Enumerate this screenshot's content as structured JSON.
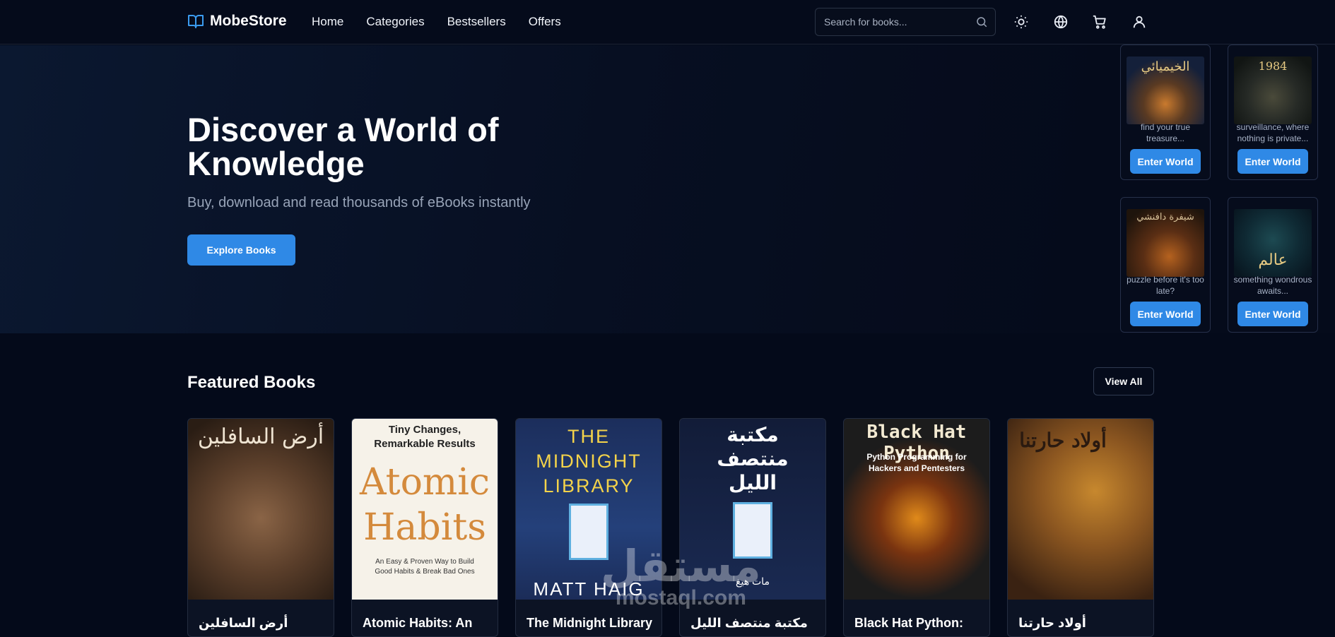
{
  "header": {
    "logo_text": "MobeStore",
    "nav": [
      "Home",
      "Categories",
      "Bestsellers",
      "Offers"
    ],
    "search_placeholder": "Search for books...",
    "icons": [
      "sun-icon",
      "globe-icon",
      "cart-icon",
      "user-icon"
    ]
  },
  "hero": {
    "title": "Discover a World of Knowledge",
    "subtitle": "Buy, download and read thousands of eBooks instantly",
    "cta": "Explore Books"
  },
  "worlds": [
    {
      "cover_text": "الخيميائي",
      "desc": "find your true treasure...",
      "button": "Enter World"
    },
    {
      "cover_text": "1984",
      "desc": "surveillance, where nothing is private...",
      "button": "Enter World"
    },
    {
      "cover_text": "شيفرة دافنشي",
      "desc": "puzzle before it's too late?",
      "button": "Enter World"
    },
    {
      "cover_text": "عالم",
      "desc": "something wondrous awaits...",
      "button": "Enter World"
    }
  ],
  "featured": {
    "title": "Featured Books",
    "view_all": "View All",
    "books": [
      {
        "title": "أرض السافلين",
        "cover_text": "أرض السافلين"
      },
      {
        "title": "Atomic Habits: An",
        "cover_top": "Tiny Changes, Remarkable Results",
        "cover_main": "Atomic Habits",
        "cover_sub": "An Easy & Proven Way to Build Good Habits & Break Bad Ones"
      },
      {
        "title": "The Midnight Library",
        "cover_main": "THE MIDNIGHT LIBRARY",
        "cover_author": "MATT HAIG"
      },
      {
        "title": "مكتبة منتصف الليل",
        "cover_main": "مكتبة منتصف الليل",
        "cover_author": "مات هيغ"
      },
      {
        "title": "Black Hat Python:",
        "cover_main": "Black Hat Python",
        "cover_sub": "Python Programming for Hackers and Pentesters"
      },
      {
        "title": "أولاد حارتنا",
        "cover_text": "أولاد حارتنا"
      }
    ]
  },
  "watermark": {
    "arabic": "مستقل",
    "latin": "mostaql.com"
  },
  "colors": {
    "accent": "#2f89e6",
    "background": "#040a1a",
    "header": "#050b1b"
  }
}
